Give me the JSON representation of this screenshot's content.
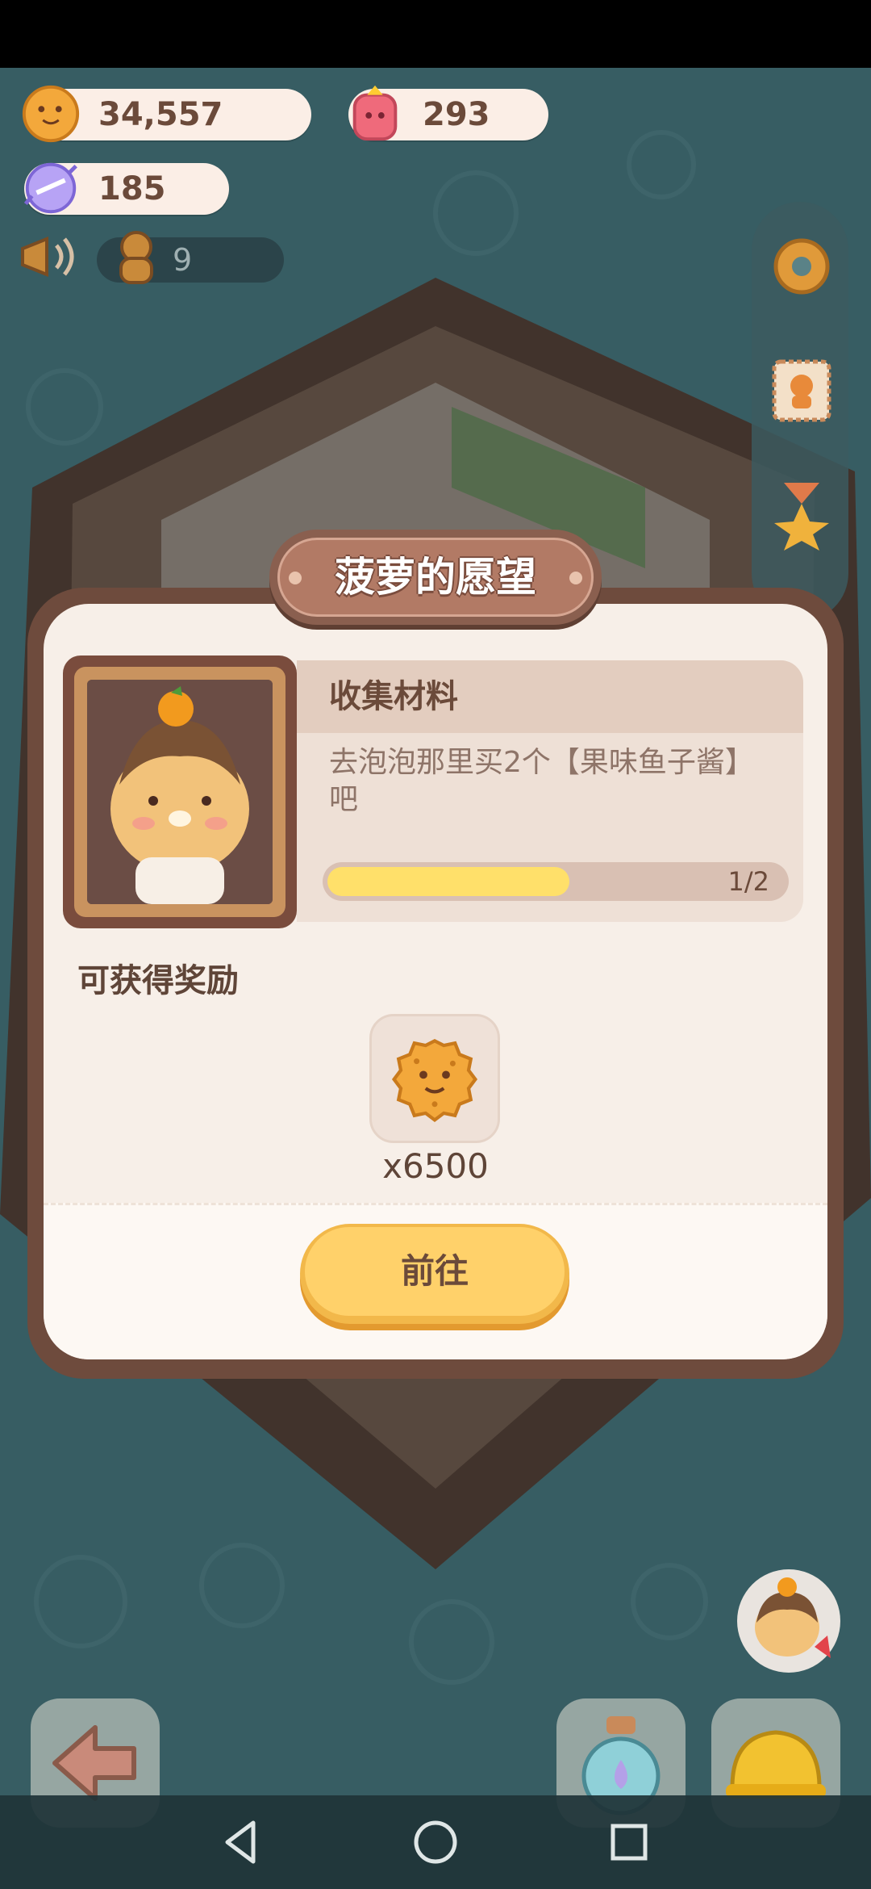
{
  "currencies": {
    "cookies": "34,557",
    "gems": "293",
    "candy": "185",
    "cookie_people": "9"
  },
  "dialog": {
    "title": "菠萝的愿望",
    "task_title": "收集材料",
    "task_desc": "去泡泡那里买2个【果味鱼子酱】吧",
    "progress": {
      "current": 1,
      "total": 2,
      "fraction": 0.5,
      "label": "1/2"
    },
    "reward_title": "可获得奖励",
    "reward_qty": "x6500",
    "go_button": "前往"
  },
  "colors": {
    "accent": "#ffd16a",
    "frame": "#6e4b3d",
    "progress_fill": "#ffe06a"
  }
}
